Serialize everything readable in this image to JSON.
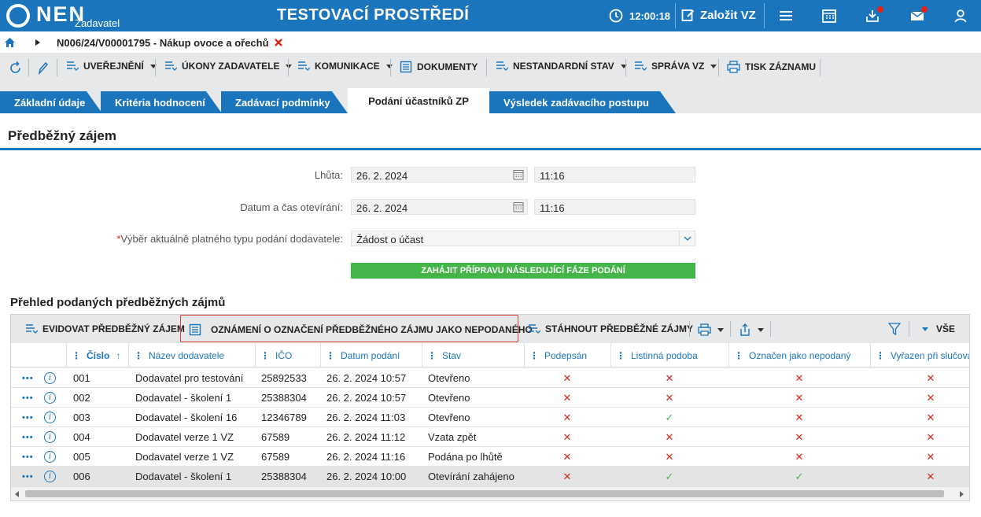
{
  "header": {
    "logo_text": "NEN",
    "logo_sub": "Zadavatel",
    "environment_title": "TESTOVACÍ PROSTŘEDÍ",
    "clock": "12:00:18",
    "create_label": "Založit VZ"
  },
  "breadcrumb": {
    "text": "N006/24/V00001795 - Nákup ovoce a ořechů"
  },
  "toolbar": {
    "items": [
      {
        "label": "UVEŘEJNĚNÍ"
      },
      {
        "label": "ÚKONY ZADAVATELE"
      },
      {
        "label": "KOMUNIKACE"
      },
      {
        "label": "DOKUMENTY"
      },
      {
        "label": "NESTANDARDNÍ STAV"
      },
      {
        "label": "SPRÁVA VZ"
      },
      {
        "label": "TISK ZÁZNAMU"
      }
    ]
  },
  "tabs": [
    {
      "label": "Základní údaje"
    },
    {
      "label": "Kritéria hodnocení"
    },
    {
      "label": "Zadávací podmínky"
    },
    {
      "label": "Podání účastníků ZP"
    },
    {
      "label": "Výsledek zadávacího postupu"
    }
  ],
  "section": {
    "title": "Předběžný zájem"
  },
  "form": {
    "deadline_label": "Lhůta:",
    "deadline_date": "26. 2. 2024",
    "deadline_time": "11:16",
    "opening_label": "Datum a čas otevírání:",
    "opening_date": "26. 2. 2024",
    "opening_time": "11:16",
    "req_mark": "*",
    "type_label": "Výběr aktuálně platného typu podání dodavatele:",
    "type_value": "Žádost o účast",
    "next_phase_button": "ZAHÁJIT PŘÍPRAVU NÁSLEDUJÍCÍ FÁZE PODÁNÍ"
  },
  "grid": {
    "title": "Přehled podaných předběžných zájmů",
    "actions": {
      "record": "EVIDOVAT PŘEDBĚŽNÝ ZÁJEM",
      "notice": "OZNÁMENÍ O OZNAČENÍ PŘEDBĚŽNÉHO ZÁJMU JAKO NEPODANÉHO",
      "download": "STÁHNOUT PŘEDBĚŽNÉ ZÁJMY",
      "all": "VŠE"
    },
    "columns": {
      "number": "Číslo",
      "supplier": "Název dodavatele",
      "ico": "IČO",
      "submitted": "Datum podání",
      "state": "Stav",
      "signed": "Podepsán",
      "paper": "Listinná podoba",
      "not_submitted": "Označen jako nepodaný",
      "excluded": "Vyřazen při slučování"
    },
    "rows": [
      {
        "number": "001",
        "supplier": "Dodavatel pro testování",
        "ico": "25892533",
        "submitted": "26. 2. 2024 10:57",
        "state": "Otevřeno",
        "signed": false,
        "paper": false,
        "not_submitted": false,
        "excluded": false
      },
      {
        "number": "002",
        "supplier": "Dodavatel - školení 1",
        "ico": "25388304",
        "submitted": "26. 2. 2024 10:57",
        "state": "Otevřeno",
        "signed": false,
        "paper": false,
        "not_submitted": false,
        "excluded": false
      },
      {
        "number": "003",
        "supplier": "Dodavatel - školení 16",
        "ico": "12346789",
        "submitted": "26. 2. 2024 11:03",
        "state": "Otevřeno",
        "signed": false,
        "paper": true,
        "not_submitted": false,
        "excluded": false
      },
      {
        "number": "004",
        "supplier": "Dodavatel verze 1 VZ",
        "ico": "67589",
        "submitted": "26. 2. 2024 11:12",
        "state": "Vzata zpět",
        "signed": false,
        "paper": false,
        "not_submitted": false,
        "excluded": false
      },
      {
        "number": "005",
        "supplier": "Dodavatel verze 1 VZ",
        "ico": "67589",
        "submitted": "26. 2. 2024 11:16",
        "state": "Podána po lhůtě",
        "signed": false,
        "paper": false,
        "not_submitted": false,
        "excluded": false
      },
      {
        "number": "006",
        "supplier": "Dodavatel - školení 1",
        "ico": "25388304",
        "submitted": "26. 2. 2024 10:00",
        "state": "Otevírání zahájeno",
        "signed": false,
        "paper": true,
        "not_submitted": true,
        "excluded": false
      }
    ],
    "selected_row": 5
  },
  "colors": {
    "brand": "#1b75bc",
    "accent_green": "#45b549",
    "error_red": "#d9261c"
  }
}
